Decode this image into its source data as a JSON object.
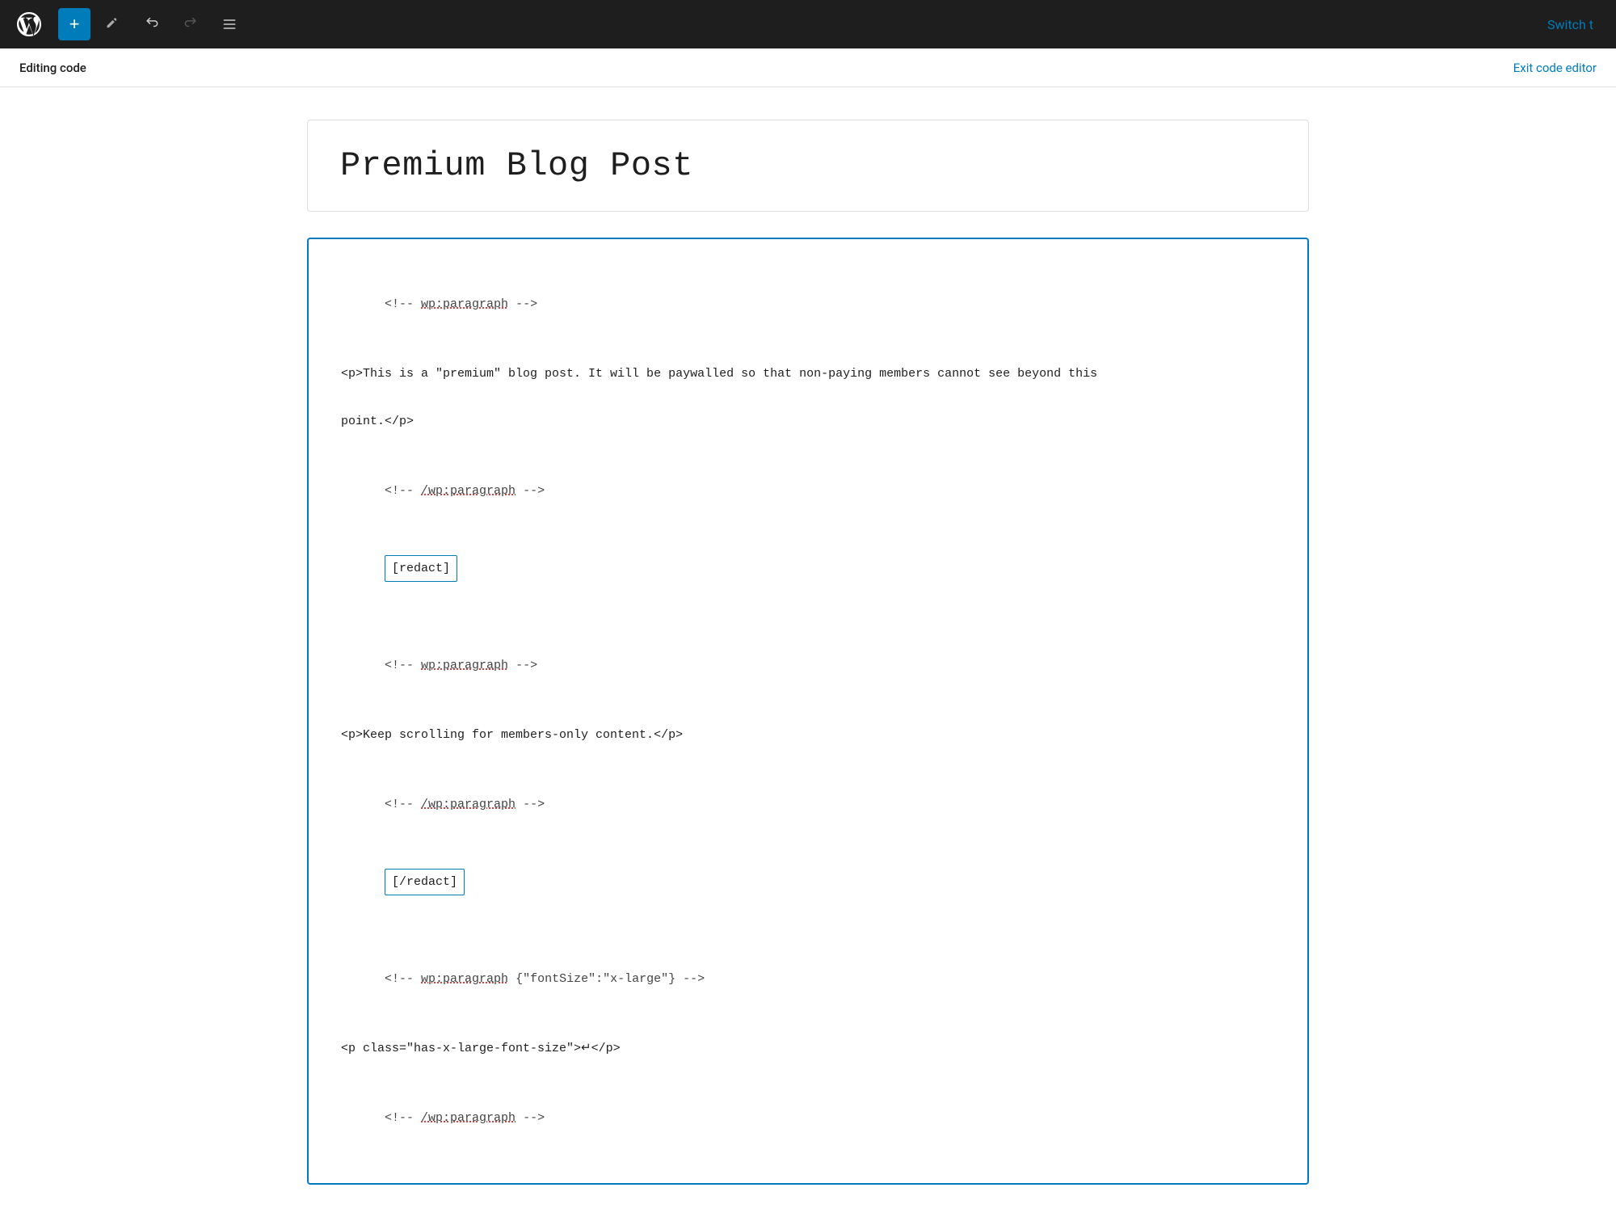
{
  "toolbar": {
    "wp_logo_alt": "WordPress",
    "add_button_label": "+",
    "switch_label": "Switch t"
  },
  "editing_bar": {
    "label": "Editing code",
    "exit_label": "Exit code editor"
  },
  "title_block": {
    "post_title": "Premium Blog Post"
  },
  "code_editor": {
    "lines": [
      {
        "type": "comment_open",
        "text": "<!-- ",
        "tag": "wp:paragraph",
        "end": " -->"
      },
      {
        "type": "blank"
      },
      {
        "type": "code",
        "text": "<p>This is a \"premium\" blog post. It will be paywalled so that non-paying members cannot see beyond this"
      },
      {
        "type": "blank"
      },
      {
        "type": "code",
        "text": "point.</p>"
      },
      {
        "type": "blank"
      },
      {
        "type": "comment_close",
        "text": "<!-- ",
        "tag": "/wp:paragraph",
        "end": " -->"
      },
      {
        "type": "redact",
        "text": "[redact]"
      },
      {
        "type": "blank"
      },
      {
        "type": "comment_open",
        "text": "<!-- ",
        "tag": "wp:paragraph",
        "end": " -->"
      },
      {
        "type": "blank"
      },
      {
        "type": "code",
        "text": "<p>Keep scrolling for members-only content.</p>"
      },
      {
        "type": "blank"
      },
      {
        "type": "comment_close",
        "text": "<!-- ",
        "tag": "/wp:paragraph",
        "end": " -->"
      },
      {
        "type": "redact",
        "text": "[/redact]"
      },
      {
        "type": "blank"
      },
      {
        "type": "comment_open_attr",
        "text": "<!-- ",
        "tag": "wp:paragraph",
        "attr": " {\"fontSize\":\"x-large\"}",
        "end": " -->"
      },
      {
        "type": "blank"
      },
      {
        "type": "code",
        "text": "<p class=\"has-x-large-font-size\">↵</p>"
      },
      {
        "type": "blank"
      },
      {
        "type": "comment_close",
        "text": "<!-- ",
        "tag": "/wp:paragraph",
        "end": " -->"
      }
    ]
  },
  "icons": {
    "add": "+",
    "pencil": "✏",
    "undo": "↩",
    "redo": "↪",
    "list": "≡"
  }
}
